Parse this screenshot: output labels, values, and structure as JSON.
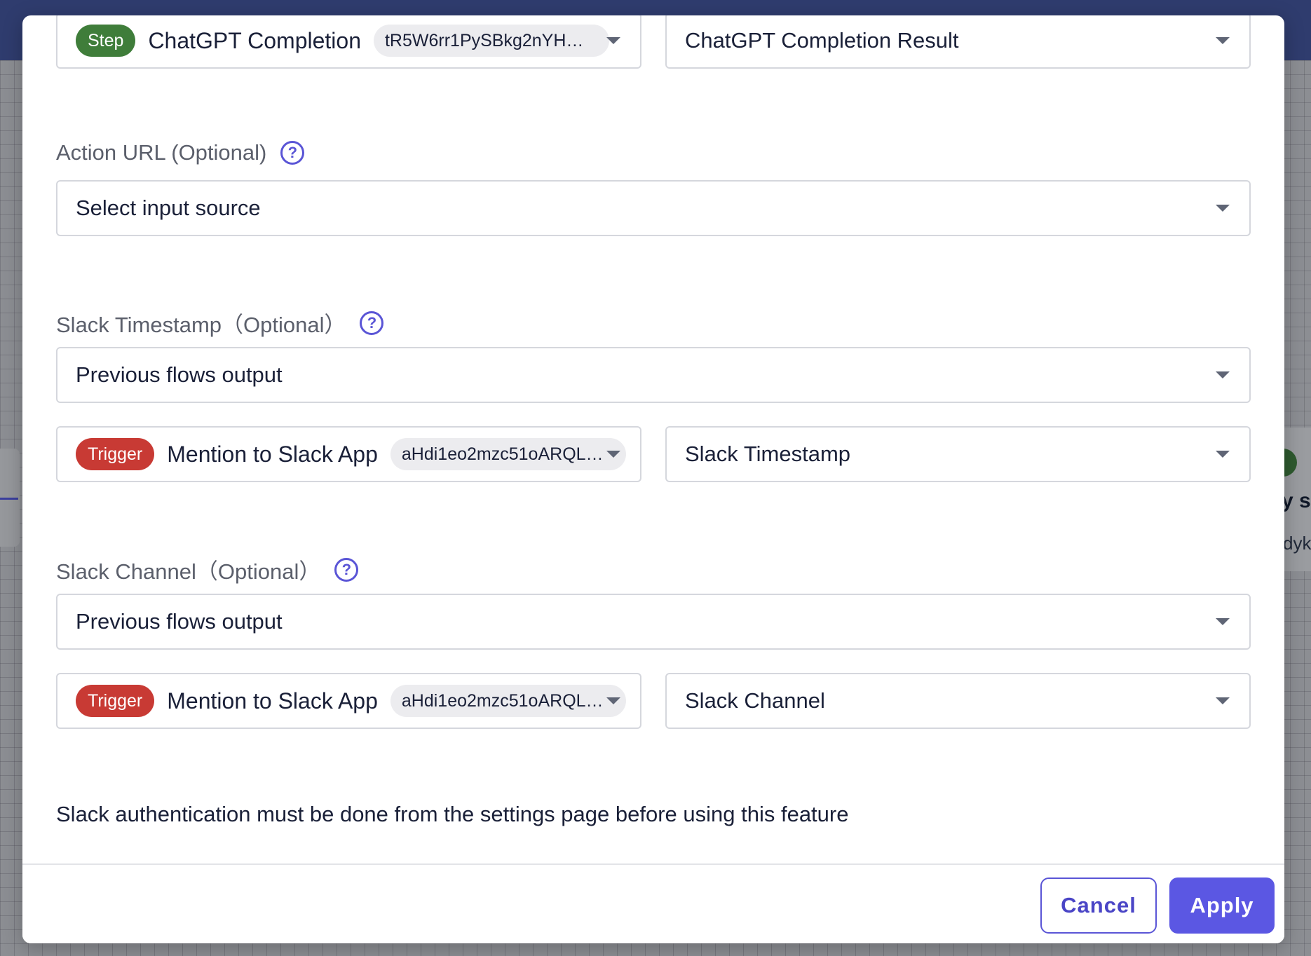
{
  "background": {
    "node_title": "y s",
    "node_sub": "dykp"
  },
  "fields": {
    "message": {
      "source_node": {
        "badge": "Step",
        "name": "ChatGPT Completion",
        "id": "tR5W6rr1PySBkg2nYHF..."
      },
      "output_field": "ChatGPT Completion Result"
    },
    "action_url": {
      "label": "Action URL (Optional)",
      "source": "Select input source"
    },
    "slack_timestamp": {
      "label": "Slack Timestamp（Optional）",
      "source": "Previous flows output",
      "source_node": {
        "badge": "Trigger",
        "name": "Mention to Slack App",
        "id": "aHdi1eo2mzc51oARQLo..."
      },
      "output_field": "Slack Timestamp"
    },
    "slack_channel": {
      "label": "Slack Channel（Optional）",
      "source": "Previous flows output",
      "source_node": {
        "badge": "Trigger",
        "name": "Mention to Slack App",
        "id": "aHdi1eo2mzc51oARQLo..."
      },
      "output_field": "Slack Channel"
    }
  },
  "help_glyph": "?",
  "note": "Slack authentication must be done from the settings page before using this feature",
  "footer": {
    "cancel_label": "Cancel",
    "apply_label": "Apply"
  },
  "colors": {
    "accent": "#5b57e3",
    "step_badge": "#3f7d3a",
    "trigger_badge": "#c83a34"
  }
}
